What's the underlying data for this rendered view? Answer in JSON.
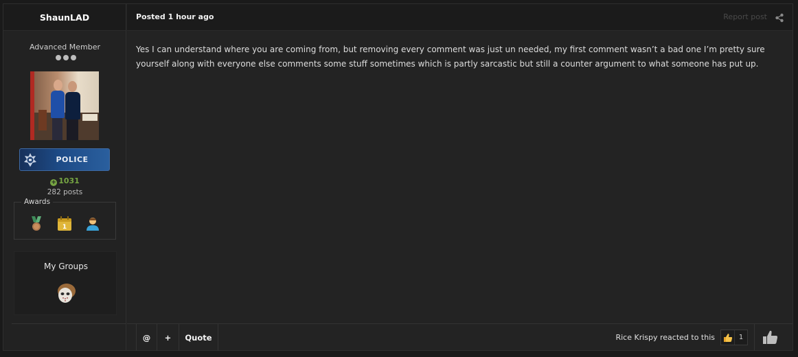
{
  "author": {
    "name": "ShaunLAD",
    "title": "Advanced Member",
    "rank_label": "POLICE",
    "reputation": "1031",
    "posts": "282 posts",
    "awards_label": "Awards",
    "groups_label": "My Groups"
  },
  "post": {
    "posted": "Posted 1 hour ago",
    "report_label": "Report post",
    "body": "Yes I can understand where you are coming from, but removing every comment was just un needed, my first comment wasn’t a bad one I’m pretty sure yourself along with everyone else comments some stuff sometimes which is partly sarcastic but still a counter argument to what someone has put up."
  },
  "footer": {
    "mention_label": "@",
    "plus_label": "+",
    "quote_label": "Quote",
    "reaction_text": "Rice Krispy reacted to this",
    "reaction_count": "1"
  },
  "colors": {
    "background": "#232323",
    "header": "#1b1b1b",
    "reputation": "#76a543",
    "rank_badge": "#1d4b87"
  }
}
